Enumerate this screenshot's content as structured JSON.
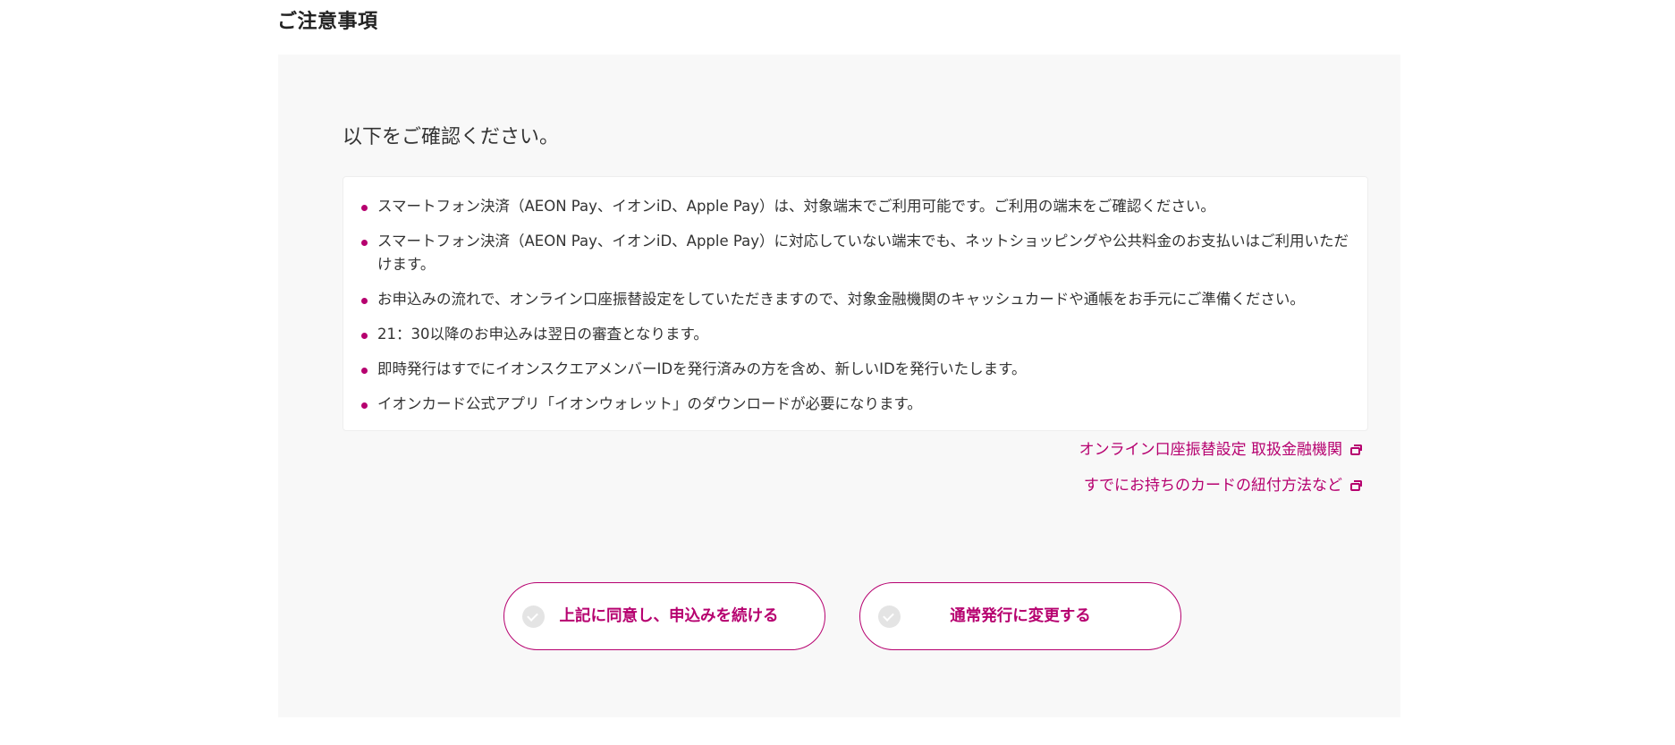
{
  "section_title": "ご注意事項",
  "confirm_heading": "以下をご確認ください。",
  "notices": [
    "スマートフォン決済（AEON Pay、イオンiD、Apple Pay）は、対象端末でご利用可能です。ご利用の端末をご確認ください。",
    "スマートフォン決済（AEON Pay、イオンiD、Apple Pay）に対応していない端末でも、ネットショッピングや公共料金のお支払いはご利用いただけます。",
    "お申込みの流れで、オンライン口座振替設定をしていただきますので、対象金融機関のキャッシュカードや通帳をお手元にご準備ください。",
    "21：30以降のお申込みは翌日の審査となります。",
    "即時発行はすでにイオンスクエアメンバーIDを発行済みの方を含め、新しいIDを発行いたします。",
    "イオンカード公式アプリ「イオンウォレット」のダウンロードが必要になります。"
  ],
  "links": {
    "bank_list": "オンライン口座振替設定 取扱金融機関",
    "link_method": "すでにお持ちのカードの紐付方法など"
  },
  "buttons": {
    "agree": "上記に同意し、申込みを続ける",
    "normal": "通常発行に変更する"
  },
  "colors": {
    "accent": "#b6006f",
    "panel_bg": "#f8f8f8",
    "check_inactive": "#e4e4e4"
  },
  "icons": {
    "external_link": "external-link-icon",
    "check": "check-circle-icon",
    "bullet": "bullet-dot-icon"
  }
}
